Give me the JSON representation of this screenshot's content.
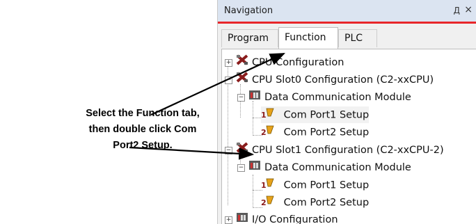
{
  "callout": {
    "line1": "Select the Function tab,",
    "line2": "then double click Com",
    "line3": "Port2 Setup."
  },
  "panel": {
    "title": "Navigation",
    "pin_glyph": "Д",
    "close_glyph": "×"
  },
  "tabs": [
    {
      "label": "Program"
    },
    {
      "label": "Function"
    },
    {
      "label": "PLC"
    }
  ],
  "tree": [
    {
      "label": "CPU Configuration",
      "icon": "cpu-config-icon",
      "expander": "+"
    },
    {
      "label": "CPU Slot0 Configuration (C2-xxCPU)",
      "icon": "cpu-config-icon",
      "expander": "−"
    },
    {
      "label": "Data Communication Module",
      "icon": "module-icon",
      "expander": "−"
    },
    {
      "label": "Com Port1 Setup",
      "icon": "com-port-icon",
      "badge": "1"
    },
    {
      "label": "Com Port2 Setup",
      "icon": "com-port-icon",
      "badge": "2"
    },
    {
      "label": "CPU Slot1 Configuration (C2-xxCPU-2)",
      "icon": "cpu-config-icon",
      "expander": "−"
    },
    {
      "label": "Data Communication Module",
      "icon": "module-icon",
      "expander": "−"
    },
    {
      "label": "Com Port1 Setup",
      "icon": "com-port-icon",
      "badge": "1"
    },
    {
      "label": "Com Port2 Setup",
      "icon": "com-port-icon",
      "badge": "2"
    },
    {
      "label": "I/O Configuration",
      "icon": "module-icon",
      "expander": "+"
    }
  ],
  "colors": {
    "accent": "#e8262a",
    "titlebar": "#dbe4f1"
  }
}
